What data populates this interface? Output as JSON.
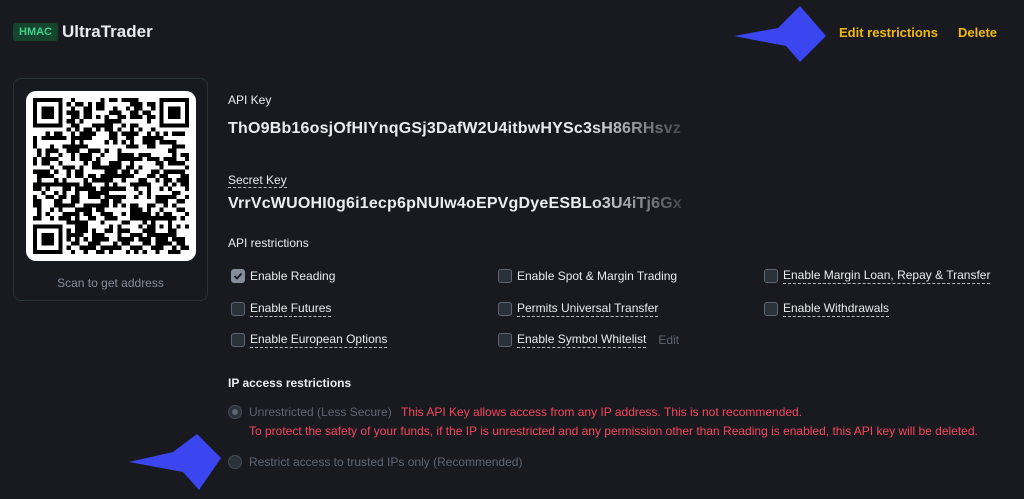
{
  "header": {
    "badge": "HMAC",
    "title": "UltraTrader",
    "edit_label": "Edit restrictions",
    "delete_label": "Delete"
  },
  "qr": {
    "caption": "Scan to get address"
  },
  "api_key": {
    "label": "API Key",
    "value": "ThO9Bb16osjOfHIYnqGSj3DafW2U4itbwHYSc3sH86RHsvz"
  },
  "secret_key": {
    "label": "Secret Key",
    "value": "VrrVcWUOHI0g6i1ecp6pNUIw4oEPVgDyeESBLo3U4iTj6Gx"
  },
  "restrictions": {
    "label": "API restrictions",
    "items": [
      {
        "label": "Enable Reading",
        "checked": true
      },
      {
        "label": "Enable Spot & Margin Trading",
        "checked": false
      },
      {
        "label": "Enable Margin Loan, Repay & Transfer",
        "checked": false
      },
      {
        "label": "Enable Futures",
        "checked": false
      },
      {
        "label": "Permits Universal Transfer",
        "checked": false
      },
      {
        "label": "Enable Withdrawals",
        "checked": false
      },
      {
        "label": "Enable European Options",
        "checked": false
      },
      {
        "label": "Enable Symbol Whitelist",
        "checked": false
      }
    ],
    "whitelist_edit": "Edit"
  },
  "ip_access": {
    "title": "IP access restrictions",
    "unrestricted_label": "Unrestricted (Less Secure)",
    "unrestricted_selected": true,
    "warning_line1": "This API Key allows access from any IP address. This is not recommended.",
    "warning_line2": "To protect the safety of your funds, if the IP is unrestricted and any permission other than Reading is enabled, this API key will be deleted.",
    "restricted_label": "Restrict access to trusted IPs only (Recommended)",
    "restricted_selected": false
  },
  "colors": {
    "background": "#181a20",
    "accent": "#f0b90b",
    "warning": "#f6465d",
    "arrow": "#3b46f0",
    "badge_bg": "#16452f",
    "badge_text": "#3fd08a"
  },
  "icons": [
    "qr-code-icon",
    "checkmark-icon",
    "pointer-arrow-icon"
  ]
}
